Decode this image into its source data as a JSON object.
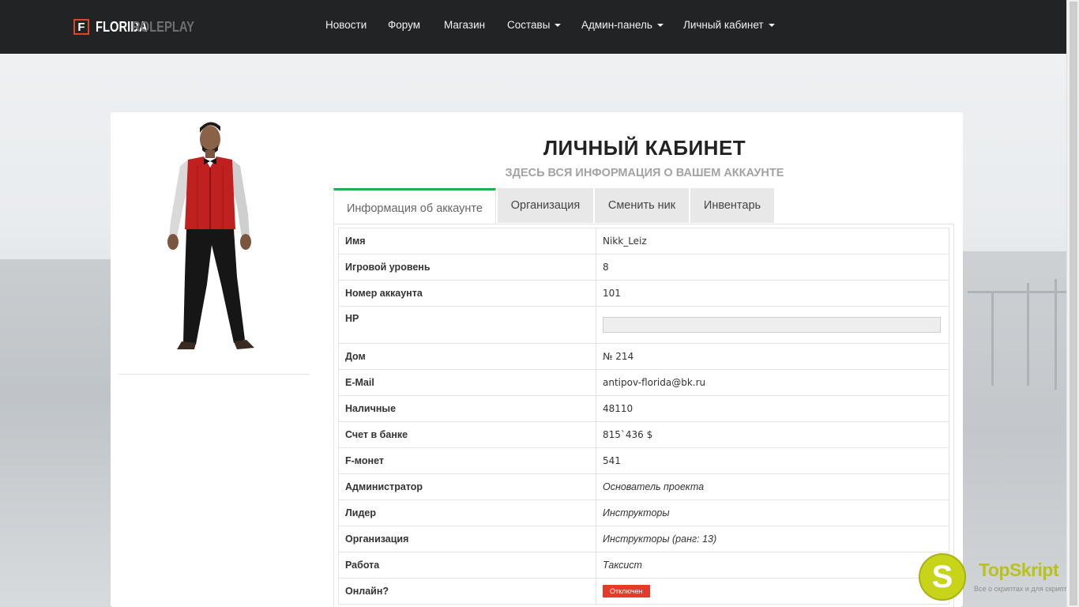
{
  "brand": {
    "logo_letter": "F",
    "name": "FLORIDA",
    "suffix": "ROLEPLAY",
    "accent_color": "#e2422a"
  },
  "nav": {
    "items": [
      {
        "label": "Новости",
        "dropdown": false
      },
      {
        "label": "Форум",
        "dropdown": false
      },
      {
        "label": "Магазин",
        "dropdown": false
      },
      {
        "label": "Составы",
        "dropdown": true
      },
      {
        "label": "Админ-панель",
        "dropdown": true
      },
      {
        "label": "Личный кабинет",
        "dropdown": true
      }
    ]
  },
  "page": {
    "title": "ЛИЧНЫЙ КАБИНЕТ",
    "subtitle": "ЗДЕСЬ ВСЯ ИНФОРМАЦИЯ О ВАШЕМ АККАУНТЕ"
  },
  "tabs": [
    {
      "label": "Информация об аккаунте",
      "active": true
    },
    {
      "label": "Организация",
      "active": false
    },
    {
      "label": "Сменить ник",
      "active": false
    },
    {
      "label": "Инвентарь",
      "active": false
    }
  ],
  "account": {
    "rows": [
      {
        "key": "Имя",
        "value": "Nikk_Leiz"
      },
      {
        "key": "Игровой уровень",
        "value": "8"
      },
      {
        "key": "Номер аккаунта",
        "value": "101"
      },
      {
        "key": "HP",
        "value": ""
      },
      {
        "key": "Дом",
        "value": "№ 214"
      },
      {
        "key": "E-Mail",
        "value": "antipov-florida@bk.ru"
      },
      {
        "key": "Наличные",
        "value": "48110"
      },
      {
        "key": "Счет в банке",
        "value": "815`436 $"
      },
      {
        "key": "F-монет",
        "value": "541"
      },
      {
        "key": "Администратор",
        "value": "Основатель проекта"
      },
      {
        "key": "Лидер",
        "value": "Инструкторы"
      },
      {
        "key": "Организация",
        "value": "Инструкторы (ранг: 13)"
      },
      {
        "key": "Работа",
        "value": "Таксист"
      },
      {
        "key": "Онлайн?",
        "value": "Отключен"
      }
    ],
    "hp_fraction": 0,
    "status_color": "#e53a27"
  },
  "watermark": {
    "letter": "S",
    "name": "TopSkript",
    "tagline": "Все о скриптах и для скриптов"
  },
  "colors": {
    "navbar": "#222324",
    "active_tab_accent": "#22b14c"
  }
}
